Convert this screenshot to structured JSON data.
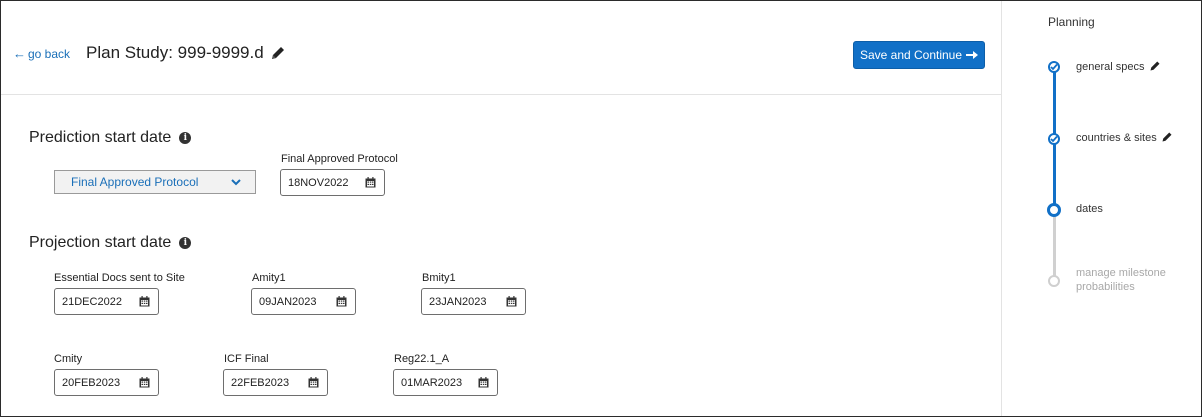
{
  "header": {
    "go_back": "go back",
    "title": "Plan Study: 999-9999.d",
    "save_button": "Save and Continue"
  },
  "prediction": {
    "title": "Prediction start date",
    "select_value": "Final Approved Protocol",
    "field_label": "Final Approved Protocol",
    "field_value": "18NOV2022"
  },
  "projection": {
    "title": "Projection start date",
    "fields": [
      {
        "label": "Essential Docs sent to Site",
        "value": "21DEC2022"
      },
      {
        "label": "Amity1",
        "value": "09JAN2023"
      },
      {
        "label": "Bmity1",
        "value": "23JAN2023"
      },
      {
        "label": "Cmity",
        "value": "20FEB2023"
      },
      {
        "label": "ICF Final",
        "value": "22FEB2023"
      },
      {
        "label": "Reg22.1_A",
        "value": "01MAR2023"
      }
    ]
  },
  "sidebar": {
    "title": "Planning",
    "steps": [
      {
        "label": "general specs",
        "state": "complete"
      },
      {
        "label": "countries & sites",
        "state": "complete"
      },
      {
        "label": "dates",
        "state": "current"
      },
      {
        "label_line1": "manage milestone",
        "label_line2": "probabilities",
        "state": "pending"
      }
    ]
  },
  "colors": {
    "accent": "#1170c7",
    "link": "#1a6fb8",
    "pending": "#d0d0d0"
  }
}
